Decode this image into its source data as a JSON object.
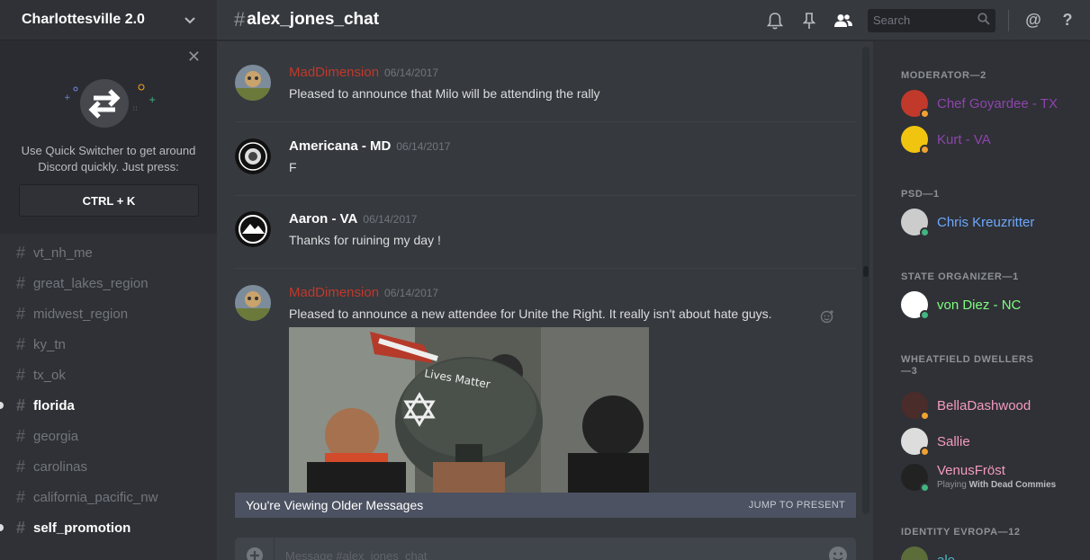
{
  "server": {
    "name": "Charlottesville 2.0"
  },
  "quick_switcher": {
    "text_line1": "Use Quick Switcher to get around",
    "text_line2": "Discord quickly. Just press:",
    "shortcut": "CTRL + K"
  },
  "channels": [
    {
      "name": "vt_nh_me",
      "unread": false
    },
    {
      "name": "great_lakes_region",
      "unread": false
    },
    {
      "name": "midwest_region",
      "unread": false
    },
    {
      "name": "ky_tn",
      "unread": false
    },
    {
      "name": "tx_ok",
      "unread": false
    },
    {
      "name": "florida",
      "unread": true
    },
    {
      "name": "georgia",
      "unread": false
    },
    {
      "name": "carolinas",
      "unread": false
    },
    {
      "name": "california_pacific_nw",
      "unread": false
    },
    {
      "name": "self_promotion",
      "unread": true
    }
  ],
  "header": {
    "hash": "#",
    "channel": "alex_jones_chat",
    "search_placeholder": "Search",
    "mention_symbol": "@",
    "help_symbol": "?"
  },
  "messages": [
    {
      "author": "MadDimension",
      "author_color": "#c0392b",
      "date": "06/14/2017",
      "text": "Pleased to announce that Milo will be attending the rally"
    },
    {
      "author": "Americana - MD",
      "author_color": "#ffffff",
      "date": "06/14/2017",
      "text": "F"
    },
    {
      "author": "Aaron - VA",
      "author_color": "#ffffff",
      "date": "06/14/2017",
      "text": "Thanks for ruining my day !"
    },
    {
      "author": "MadDimension",
      "author_color": "#c0392b",
      "date": "06/14/2017",
      "text": "Pleased to announce a new attendee for Unite the Right. It really isn't about hate guys."
    }
  ],
  "older_bar": {
    "text": "You're Viewing Older Messages",
    "jump": "JUMP TO PRESENT"
  },
  "composer": {
    "placeholder": "Message #alex_jones_chat"
  },
  "member_groups": [
    {
      "title": "MODERATOR—2",
      "members": [
        {
          "name": "Chef Goyardee - TX",
          "color": "#8e44ad",
          "status": "#f0a131"
        },
        {
          "name": "Kurt - VA",
          "color": "#8e44ad",
          "status": "#f0a131"
        }
      ]
    },
    {
      "title": "PSD—1",
      "members": [
        {
          "name": "Chris Kreuzritter",
          "color": "#6ea8ff",
          "status": "#43b581"
        }
      ]
    },
    {
      "title": "STATE ORGANIZER—1",
      "members": [
        {
          "name": "von Diez - NC",
          "color": "#7fff7f",
          "status": "#43b581"
        }
      ]
    },
    {
      "title": "WHEATFIELD DWELLERS—3",
      "members": [
        {
          "name": "BellaDashwood",
          "color": "#f49ac1",
          "status": "#f0a131"
        },
        {
          "name": "Sallie",
          "color": "#f49ac1",
          "status": "#f0a131"
        },
        {
          "name": "VenusFröst",
          "color": "#f49ac1",
          "status": "#43b581",
          "activity_prefix": "Playing",
          "activity": "With Dead Commies"
        }
      ]
    },
    {
      "title": "IDENTITY EVROPA—12",
      "members": [
        {
          "name": "ale",
          "color": "#4ab8c9",
          "status": "#43b581"
        }
      ]
    }
  ],
  "colors": {
    "background": "#36393e",
    "sidebar": "#2f3136",
    "accent": "#7289da"
  }
}
